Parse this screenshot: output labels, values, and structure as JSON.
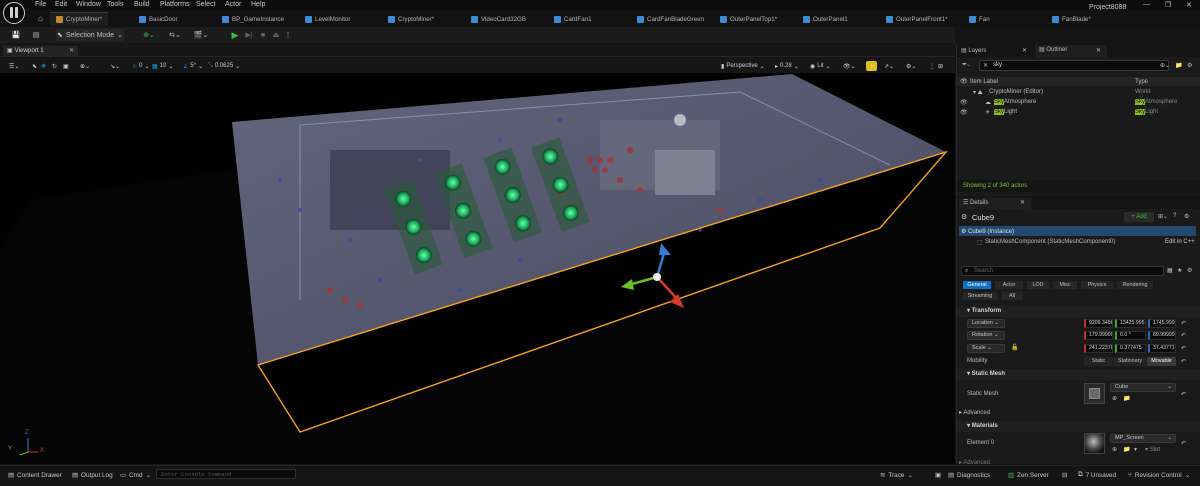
{
  "menu": [
    "File",
    "Edit",
    "Window",
    "Tools",
    "Build",
    "Platforms",
    "Select",
    "Actor",
    "Help"
  ],
  "project_name": "Project8088",
  "tabs": [
    {
      "label": "CryptoMiner*",
      "active": true
    },
    {
      "label": "BasicDoor"
    },
    {
      "label": "BP_GameInstance"
    },
    {
      "label": "LevelMonitor"
    },
    {
      "label": "CryptoMiner*"
    },
    {
      "label": "VideoCard32GB"
    },
    {
      "label": "CardFan1"
    },
    {
      "label": "CardFanBladeGreen"
    },
    {
      "label": "OuterPanelTop1*"
    },
    {
      "label": "OuterPanel1"
    },
    {
      "label": "OuterPanelFront1*"
    },
    {
      "label": "Fan"
    },
    {
      "label": "FanBlade*"
    }
  ],
  "toolbar": {
    "selection_mode": "Selection Mode"
  },
  "viewport": {
    "tab_label": "Viewport 1",
    "grid_snap": "0",
    "grid_size": "10",
    "rot_snap": "5°",
    "scale_snap": "0.0625",
    "view_mode": "Perspective",
    "cam_speed": "0.28",
    "lit": "Lit",
    "axis_labels": {
      "x": "X",
      "y": "Y",
      "z": "Z"
    }
  },
  "outliner": {
    "tab_layers": "Layers",
    "tab_outliner": "Outliner",
    "search_value": "sky",
    "col_label": "Item Label",
    "col_type": "Type",
    "rows": [
      {
        "label": "CryptoMiner (Editor)",
        "type": "World",
        "indent": 0
      },
      {
        "label_hl": "Sky",
        "label_rest": "Atmosphere",
        "type_hl": "Sky",
        "type_rest": "Atmosphere",
        "indent": 1
      },
      {
        "label_hl": "Sky",
        "label_rest": "Light",
        "type_hl": "Sky",
        "type_rest": "Light",
        "indent": 1
      }
    ],
    "footer": "Showing 2 of 340 actors"
  },
  "details": {
    "tab_label": "Details",
    "actor_name": "Cube9",
    "add_label": "+ Add",
    "instance_label": "Cube9 (Instance)",
    "component_label": "StaticMeshComponent (StaticMeshComponent0)",
    "edit_cpp": "Edit in C++",
    "search_placeholder": "Search",
    "filters_row1": [
      "General",
      "Actor",
      "LOD",
      "Misc",
      "Physics",
      "Rendering"
    ],
    "filters_row2": [
      "Streaming",
      "All"
    ],
    "transform_header": "Transform",
    "location_label": "Location",
    "location": [
      "9209.3456",
      "13425.995",
      "1745.9999"
    ],
    "rotation_label": "Rotation",
    "rotation": [
      "179.99999",
      "0.0 °",
      "89.99999"
    ],
    "scale_label": "Scale",
    "scale": [
      "241.22376",
      "0.377475",
      "37.43771"
    ],
    "mobility_label": "Mobility",
    "mobility_options": [
      "Static",
      "Stationary",
      "Movable"
    ],
    "mobility_selected": "Movable",
    "static_mesh_header": "Static Mesh",
    "static_mesh_label": "Static Mesh",
    "static_mesh_value": "Cube",
    "advanced_label": "Advanced",
    "materials_header": "Materials",
    "element0_label": "Element 0",
    "element0_value": "MP_Screen",
    "slot_label": "Slot",
    "advanced2_label": "Advanced"
  },
  "statusbar": {
    "content_drawer": "Content Drawer",
    "output_log": "Output Log",
    "cmd": "Cmd",
    "console_placeholder": "Enter Console Command",
    "trace": "Trace",
    "diagnostics": "Diagnostics",
    "zen": "Zen Server",
    "unsaved": "7 Unsaved",
    "revision": "Revision Control"
  },
  "colors": {
    "accent": "#0e70c0",
    "highlight": "#8fc21e",
    "selection": "#f5a020",
    "play": "#3cbc3c"
  }
}
